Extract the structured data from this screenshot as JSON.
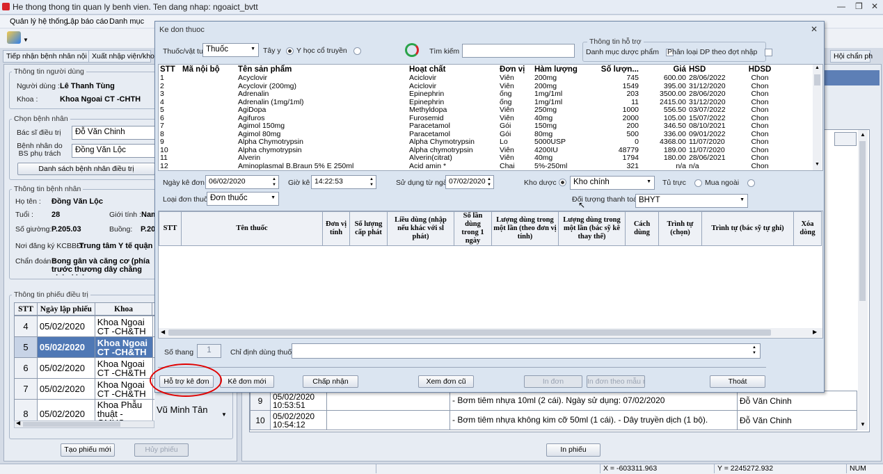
{
  "app_title": "He thong thong tin quan ly benh vien. Ten dang nhap: ngoaict_bvtt",
  "menu": [
    "Quản lý hệ thống",
    "Lập báo cáo",
    "Danh mục"
  ],
  "tabs": [
    "Tiếp nhận bệnh nhân nội trú",
    "Xuất nhập viện/khoa",
    "Hội chẩn ph"
  ],
  "left": {
    "user_group": "Thông tin người dùng",
    "user_label": "Người dùng :",
    "user": "Lê Thanh Tùng",
    "dept_label": "Khoa :",
    "dept": "Khoa Ngoai CT -CHTH",
    "choose_group": "Chọn bệnh nhân",
    "doctor_label": "Bác sĩ điều trị",
    "doctor": "Đỗ Văn Chinh",
    "patient_by_label": "Bệnh nhân do BS phụ trách",
    "patient_by": "Đồng Văn Lộc",
    "list_button": "Danh sách bệnh nhân điều trị",
    "info_group": "Thông tin bệnh nhân",
    "name_label": "Họ tên :",
    "name": "Đồng Văn Lộc",
    "age_label": "Tuổi :",
    "age": "28",
    "sex_label": "Giới tính :",
    "sex": "Nam",
    "bed_label": "Số giường:",
    "bed": "P.205.03",
    "room_label": "Buồng:",
    "room": "P.20",
    "reg_label": "Nơi đăng ký KCBBĐ:",
    "reg": "Trung tâm Y tế quận Du",
    "diag_label": "Chẩn đoán :",
    "diag": "Bong gân và căng cơ (phía trước thương dây chằng chéo khớp g",
    "sheet_group": "Thông tin phiếu điều trị",
    "sheet_cols": [
      "STT",
      "Ngày lập phiếu",
      "Khoa"
    ],
    "sheet_rows": [
      {
        "stt": "4",
        "date": "05/02/2020",
        "khoa": "Khoa Ngoai CT -CH&TH",
        "bs": ""
      },
      {
        "stt": "5",
        "date": "05/02/2020",
        "khoa": "Khoa Ngoai CT -CH&TH",
        "bs": ""
      },
      {
        "stt": "6",
        "date": "05/02/2020",
        "khoa": "Khoa Ngoai CT -CH&TH",
        "bs": ""
      },
      {
        "stt": "7",
        "date": "05/02/2020",
        "khoa": "Khoa Ngoai CT -CH&TH",
        "bs": ""
      },
      {
        "stt": "8",
        "date": "05/02/2020",
        "khoa": "Khoa Phẫu thuật - GMHS",
        "bs": "Vũ Minh Tân"
      }
    ],
    "new_sheet_button": "Tạo phiếu mới",
    "cancel_sheet_button": "Hủy phiếu"
  },
  "right_bg": {
    "rows": [
      {
        "stt": "9",
        "time": "05/02/2020 10:53:51",
        "content": "- Bơm tiêm nhựa 10ml (2 cái). Ngày sử dụng: 07/02/2020",
        "doctor": "Đỗ Văn Chinh"
      },
      {
        "stt": "10",
        "time": "05/02/2020 10:54:12",
        "content": "- Bơm tiêm nhựa không kim cỡ 50ml (1 cái). - Dây truyền dịch (1 bộ).",
        "doctor": "Đỗ Văn Chinh"
      }
    ],
    "print_button": "In phiếu"
  },
  "status": {
    "x": "X = -603311.963",
    "y": "Y = 2245272.932",
    "num": "NUM"
  },
  "dialog": {
    "title": "Ke don thuoc",
    "type_label": "Thuốc/vật tư",
    "type_value": "Thuốc",
    "opt_western": "Tây y",
    "opt_traditional": "Y học cổ truyền",
    "search_label": "Tìm kiếm",
    "search_value": "",
    "support_group": "Thông tin hỗ trợ",
    "chk_list": "Danh mục dược phẩm",
    "chk_classify": "Phân loại DP theo đợt nhập",
    "product_cols": [
      "STT",
      "Mã nội bộ",
      "Tên sản phẩm",
      "Hoạt chất",
      "Đơn vị",
      "Hàm lượng",
      "Số lượn...",
      "Giá",
      "HSD",
      "HDSD"
    ],
    "products": [
      [
        "1",
        "",
        "Acyclovir",
        "Aciclovir",
        "Viên",
        "200mg",
        "745",
        "600.00",
        "28/06/2022",
        "Chon"
      ],
      [
        "2",
        "",
        "Acyclovir (200mg)",
        "Aciclovir",
        "Viên",
        "200mg",
        "1549",
        "395.00",
        "31/12/2020",
        "Chon"
      ],
      [
        "3",
        "",
        "Adrenalin",
        "Epinephrin",
        "ống",
        "1mg/1ml",
        "203",
        "3500.00",
        "28/06/2020",
        "Chon"
      ],
      [
        "4",
        "",
        "Adrenalin (1mg/1ml)",
        "Epinephrin",
        "ống",
        "1mg/1ml",
        "11",
        "2415.00",
        "31/12/2020",
        "Chon"
      ],
      [
        "5",
        "",
        "AgiDopa",
        "Methyldopa",
        "Viên",
        "250mg",
        "1000",
        "556.50",
        "03/07/2022",
        "Chon"
      ],
      [
        "6",
        "",
        "Agifuros",
        "Furosemid",
        "Viên",
        "40mg",
        "2000",
        "105.00",
        "15/07/2022",
        "Chon"
      ],
      [
        "7",
        "",
        "Agimol 150mg",
        "Paracetamol",
        "Gói",
        "150mg",
        "200",
        "346.50",
        "08/10/2021",
        "Chon"
      ],
      [
        "8",
        "",
        "Agimol 80mg",
        "Paracetamol",
        "Gói",
        "80mg",
        "500",
        "336.00",
        "09/01/2022",
        "Chon"
      ],
      [
        "9",
        "",
        "Alpha Chymotrypsin",
        "Alpha Chymotrypsin",
        "Lo",
        "5000USP",
        "0",
        "4368.00",
        "11/07/2020",
        "Chon"
      ],
      [
        "10",
        "",
        "Alpha chymotrypsin",
        "Alpha chymotrypsin",
        "Viên",
        "4200IU",
        "48779",
        "189.00",
        "11/07/2020",
        "Chon"
      ],
      [
        "11",
        "",
        "Alverin",
        "Alverin(citrat)",
        "Viên",
        "40mg",
        "1794",
        "180.00",
        "28/06/2021",
        "Chon"
      ],
      [
        "12",
        "",
        "Aminoplasmal B.Braun 5% E 250ml",
        "Acid amin *",
        "Chai",
        "5%-250ml",
        "321",
        "n/a",
        "n/a",
        "Chon"
      ]
    ],
    "date_label": "Ngày kê đơn",
    "date": "06/02/2020",
    "time_label": "Giờ kê",
    "time": "14:22:53",
    "use_from_label": "Sử dụng từ ngày",
    "use_from": "07/02/2020",
    "store_label": "Kho dược",
    "store": "Kho chính",
    "cabinet_label": "Tủ trực",
    "outside_label": "Mua ngoài",
    "kind_label": "Loại đơn thuốc",
    "kind": "Đơn thuốc",
    "payer_label": "Đối tượng thanh toán",
    "payer": "BHYT",
    "rx_cols": [
      "STT",
      "Tên thuốc",
      "Đơn vị tính",
      "Số lượng cấp phát",
      "Liều dùng (nhập nếu khác với sl phát)",
      "Số lần dùng trong 1 ngày",
      "Lượng dùng trong một lần (theo đơn vị tính)",
      "Lượng dùng trong một lần (bác sỹ kê thay thế)",
      "Cách dùng",
      "Trình tự (chọn)",
      "Trình tự (bác sỹ tự ghi)",
      "Xóa dòng"
    ],
    "months_label": "Số thang",
    "months": "1",
    "instruction_label": "Chỉ định dùng thuốc",
    "instruction": "",
    "buttons": {
      "support": "Hỗ trợ kê đơn",
      "new": "Kê đơn mới",
      "accept": "Chấp nhận",
      "old": "Xem đơn cũ",
      "print": "In đơn",
      "print_template": "In đơn theo mẫu mới",
      "exit": "Thoát"
    },
    "highlight_color": "#e00000"
  }
}
